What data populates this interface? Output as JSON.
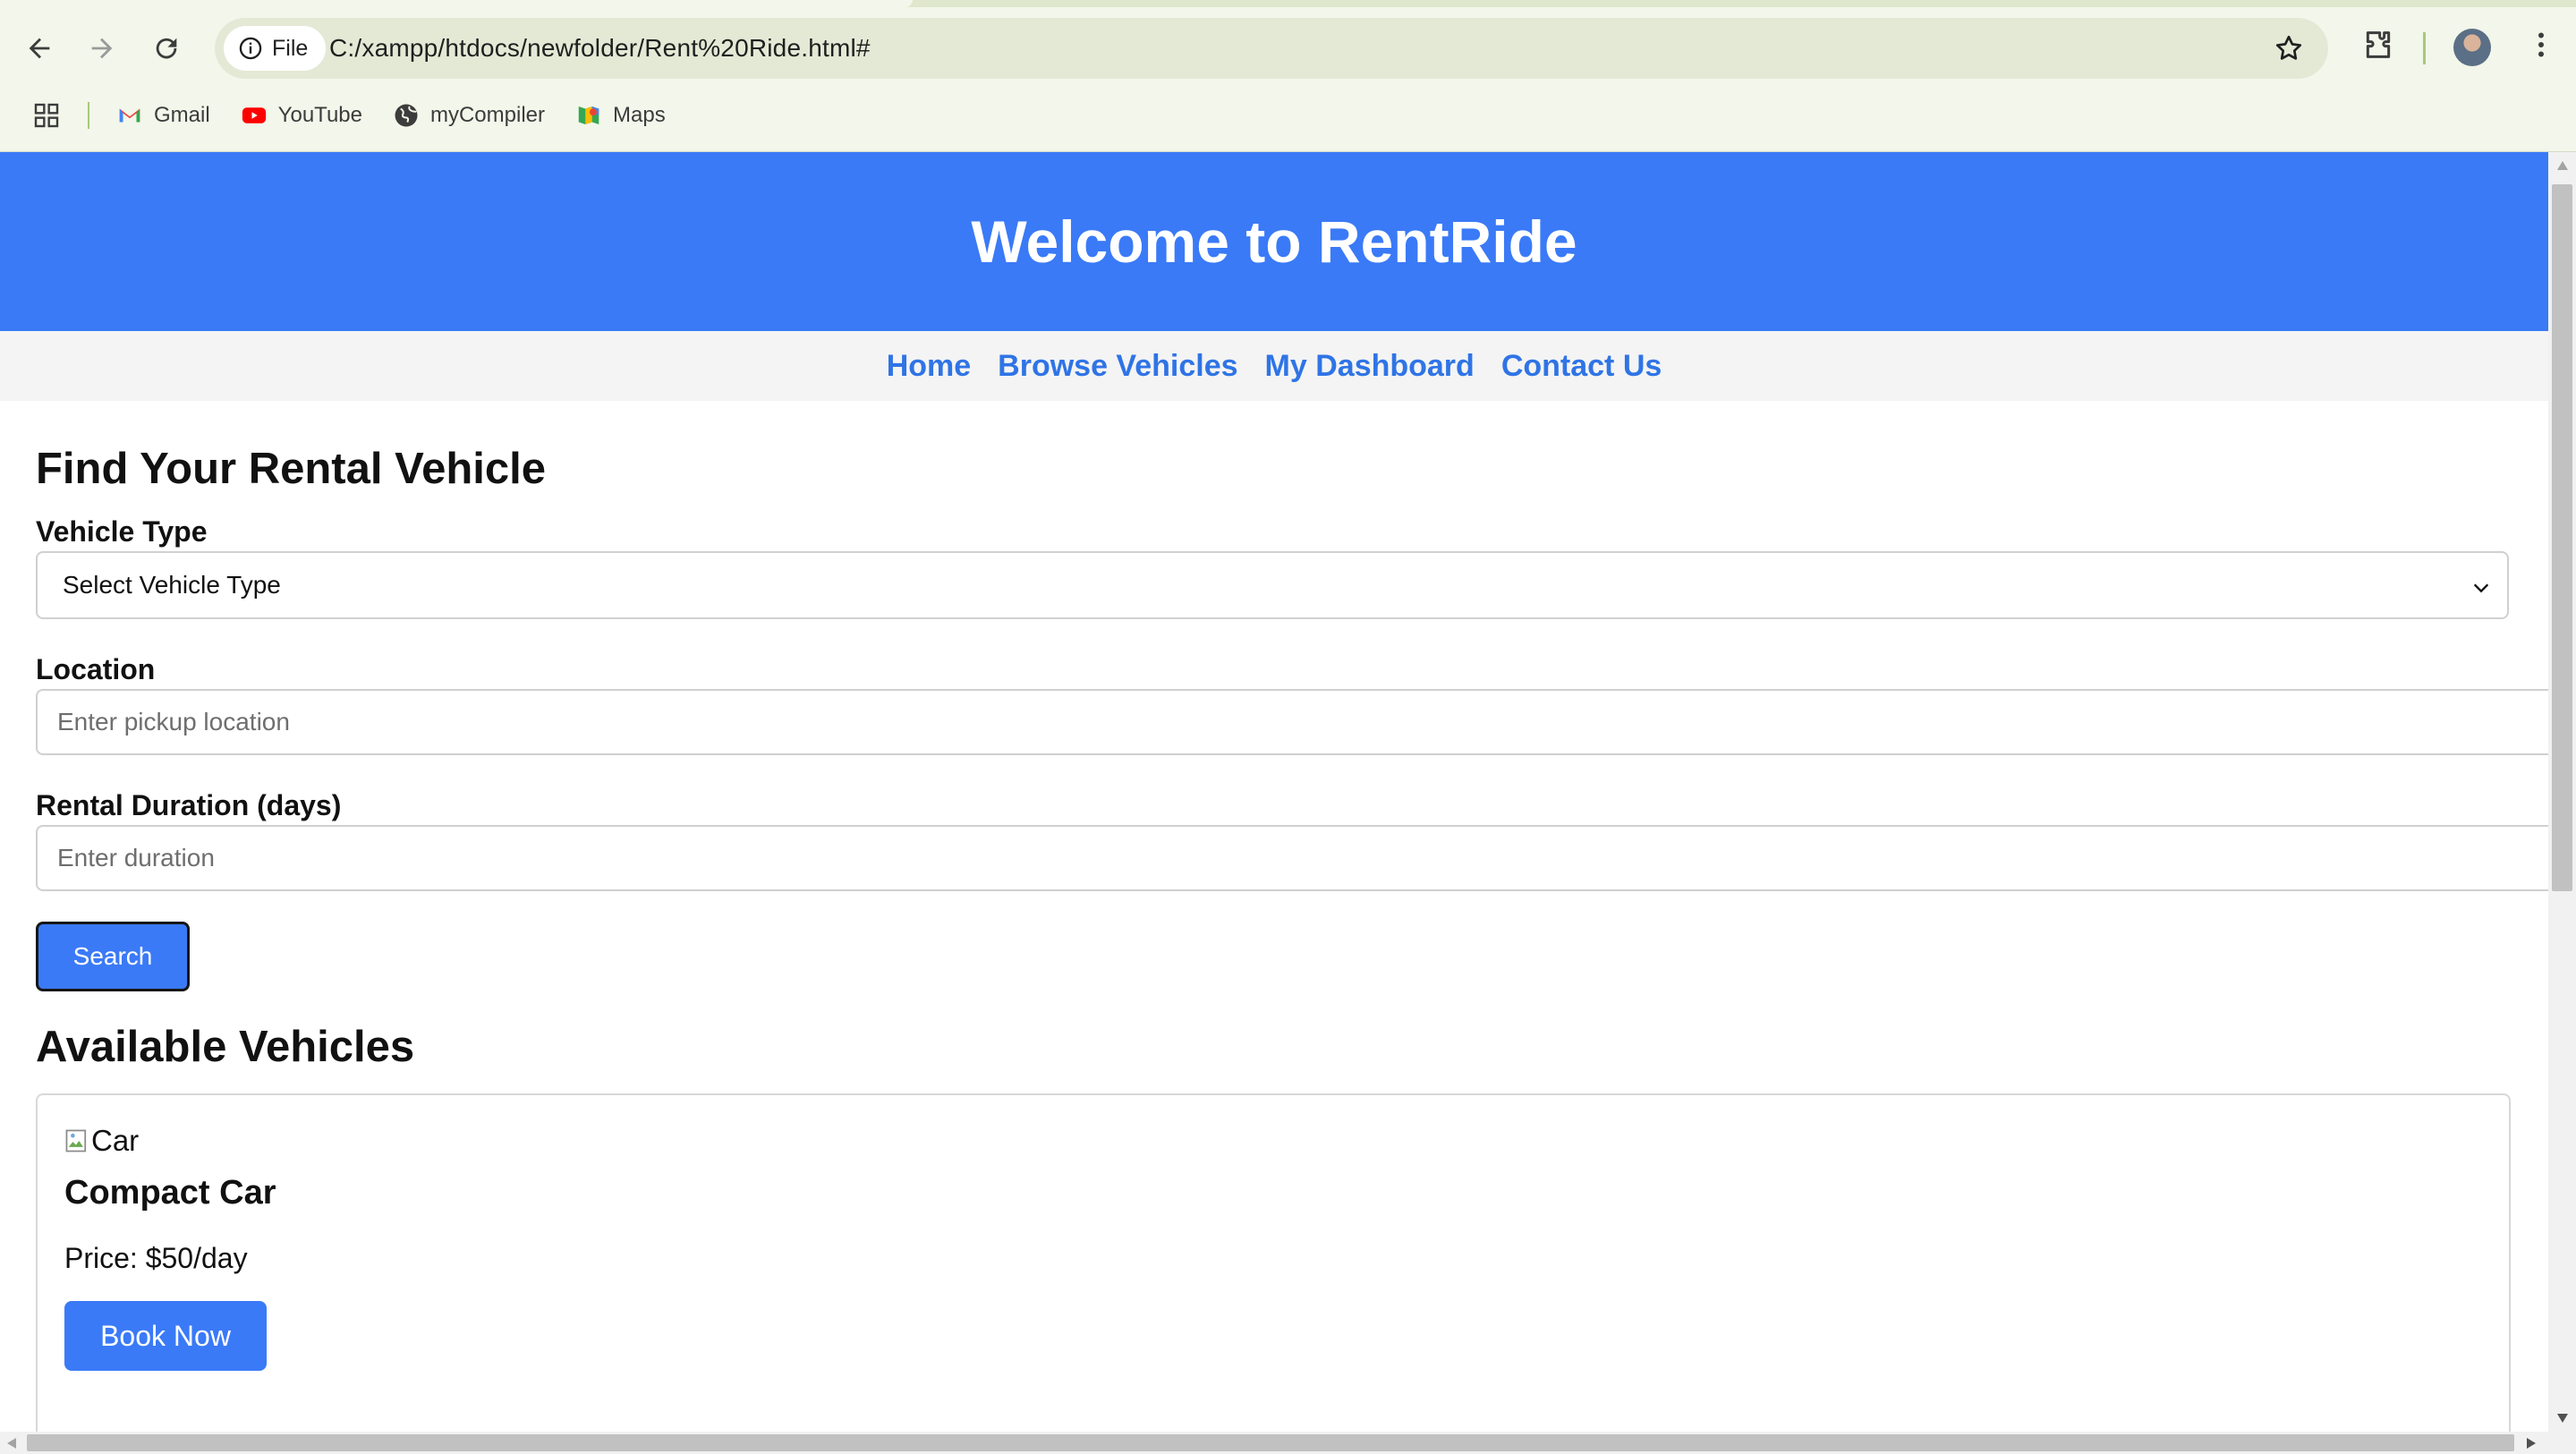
{
  "browser": {
    "site_chip_label": "File",
    "url": "C:/xampp/htdocs/newfolder/Rent%20Ride.html#",
    "bookmarks": [
      {
        "label": "Gmail",
        "icon": "gmail-icon"
      },
      {
        "label": "YouTube",
        "icon": "youtube-icon"
      },
      {
        "label": "myCompiler",
        "icon": "globe-icon"
      },
      {
        "label": "Maps",
        "icon": "maps-icon"
      }
    ]
  },
  "header": {
    "title": "Welcome to RentRide",
    "color": "#3a7af7"
  },
  "nav": {
    "items": [
      {
        "label": "Home"
      },
      {
        "label": "Browse Vehicles"
      },
      {
        "label": "My Dashboard"
      },
      {
        "label": "Contact Us"
      }
    ],
    "link_color": "#2f74e6"
  },
  "search": {
    "title": "Find Your Rental Vehicle",
    "vehicle_type_label": "Vehicle Type",
    "vehicle_type_selected": "Select Vehicle Type",
    "location_label": "Location",
    "location_placeholder": "Enter pickup location",
    "duration_label": "Rental Duration (days)",
    "duration_placeholder": "Enter duration",
    "search_button": "Search"
  },
  "vehicles": {
    "title": "Available Vehicles",
    "items": [
      {
        "image_alt": "Car",
        "name": "Compact Car",
        "price": "Price: $50/day",
        "book_label": "Book Now"
      }
    ]
  }
}
